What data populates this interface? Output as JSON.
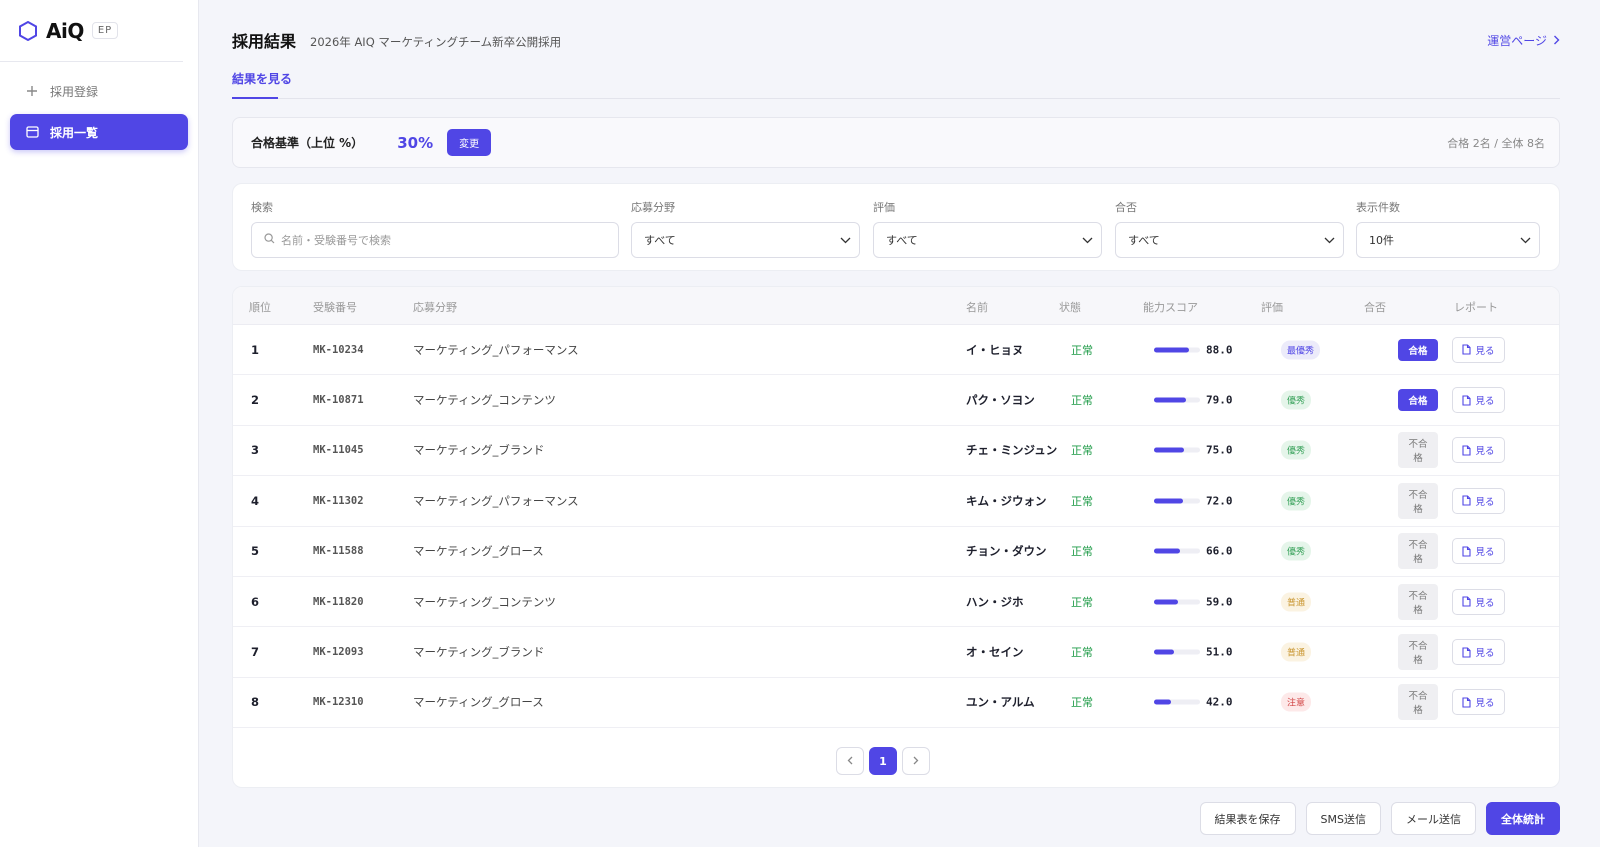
{
  "sidebar": {
    "logo_text": "AiQ",
    "logo_badge": "EP",
    "items": [
      {
        "label": "採用登録",
        "icon": "plus-icon",
        "active": false
      },
      {
        "label": "採用一覧",
        "icon": "calendar-icon",
        "active": true
      }
    ]
  },
  "header": {
    "title": "採用結果",
    "subtitle": "2026年 AIQ マーケティングチーム新卒公開採用",
    "ops_link": "運営ページ"
  },
  "tabs": [
    {
      "label": "結果を見る",
      "active": true
    }
  ],
  "criteria": {
    "label": "合格基準（上位 %）",
    "value": "30%",
    "change_button": "変更",
    "count_text": "合格 2名 / 全体 8名"
  },
  "filters": {
    "search_label": "検索",
    "search_placeholder": "名前・受験番号で検索",
    "field_label": "応募分野",
    "field_value": "すべて",
    "grade_label": "評価",
    "grade_value": "すべて",
    "pass_label": "合否",
    "pass_value": "すべて",
    "count_label": "表示件数",
    "count_value": "10件"
  },
  "table": {
    "headers": {
      "rank": "順位",
      "id": "受験番号",
      "field": "応募分野",
      "name": "名前",
      "status": "状態",
      "score": "能力スコア",
      "grade": "評価",
      "pass": "合否",
      "report": "レポート"
    },
    "report_label": "見る",
    "rows": [
      {
        "rank": "1",
        "id": "MK-10234",
        "field": "マーケティング_パフォーマンス",
        "name": "イ・ヒョヌ",
        "status": "正常",
        "score": "88.0",
        "grade": "最優秀",
        "grade_type": "top",
        "pass": "合格"
      },
      {
        "rank": "2",
        "id": "MK-10871",
        "field": "マーケティング_コンテンツ",
        "name": "パク・ソヨン",
        "status": "正常",
        "score": "79.0",
        "grade": "優秀",
        "grade_type": "good",
        "pass": "合格"
      },
      {
        "rank": "3",
        "id": "MK-11045",
        "field": "マーケティング_ブランド",
        "name": "チェ・ミンジュン",
        "status": "正常",
        "score": "75.0",
        "grade": "優秀",
        "grade_type": "good",
        "pass": "不合格"
      },
      {
        "rank": "4",
        "id": "MK-11302",
        "field": "マーケティング_パフォーマンス",
        "name": "キム・ジウォン",
        "status": "正常",
        "score": "72.0",
        "grade": "優秀",
        "grade_type": "good",
        "pass": "不合格"
      },
      {
        "rank": "5",
        "id": "MK-11588",
        "field": "マーケティング_グロース",
        "name": "チョン・ダウン",
        "status": "正常",
        "score": "66.0",
        "grade": "優秀",
        "grade_type": "good",
        "pass": "不合格"
      },
      {
        "rank": "6",
        "id": "MK-11820",
        "field": "マーケティング_コンテンツ",
        "name": "ハン・ジホ",
        "status": "正常",
        "score": "59.0",
        "grade": "普通",
        "grade_type": "avg",
        "pass": "不合格"
      },
      {
        "rank": "7",
        "id": "MK-12093",
        "field": "マーケティング_ブランド",
        "name": "オ・セイン",
        "status": "正常",
        "score": "51.0",
        "grade": "普通",
        "grade_type": "avg",
        "pass": "不合格"
      },
      {
        "rank": "8",
        "id": "MK-12310",
        "field": "マーケティング_グロース",
        "name": "ユン・アルム",
        "status": "正常",
        "score": "42.0",
        "grade": "注意",
        "grade_type": "warn",
        "pass": "不合格"
      }
    ]
  },
  "pagination": {
    "current": "1"
  },
  "actions": {
    "save": "結果表を保存",
    "sms": "SMS送信",
    "mail": "メール送信",
    "stats": "全体統計"
  },
  "colors": {
    "accent": "#5046e5",
    "status_ok": "#1e9b47"
  }
}
